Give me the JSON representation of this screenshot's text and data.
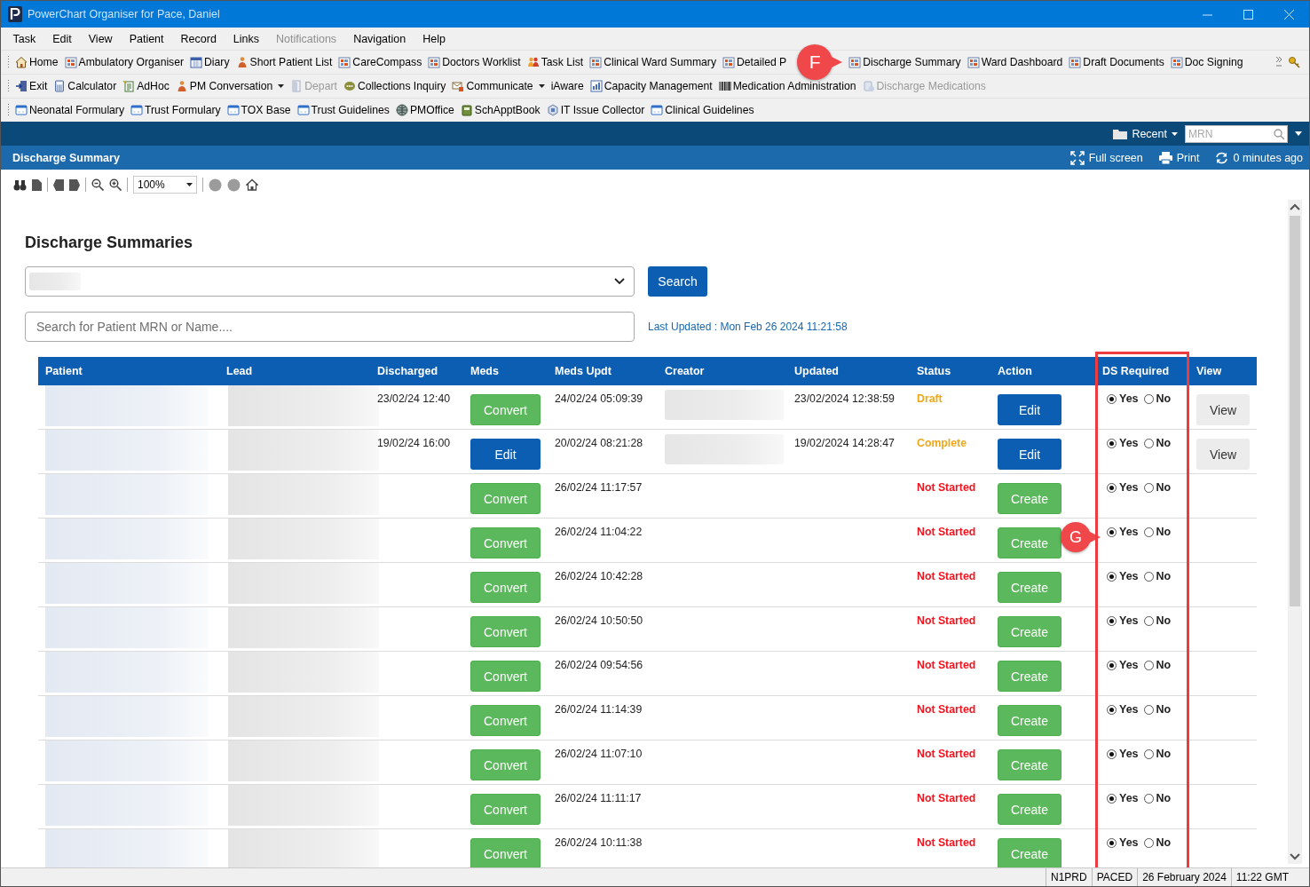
{
  "window": {
    "title": "PowerChart Organiser for Pace, Daniel"
  },
  "menu": [
    {
      "label": "Task",
      "disabled": false
    },
    {
      "label": "Edit",
      "disabled": false
    },
    {
      "label": "View",
      "disabled": false
    },
    {
      "label": "Patient",
      "disabled": false
    },
    {
      "label": "Record",
      "disabled": false
    },
    {
      "label": "Links",
      "disabled": false
    },
    {
      "label": "Notifications",
      "disabled": true
    },
    {
      "label": "Navigation",
      "disabled": false
    },
    {
      "label": "Help",
      "disabled": false
    }
  ],
  "toolbars": [
    {
      "items": [
        {
          "label": "Home",
          "kind": "home"
        },
        {
          "label": "Ambulatory Organiser",
          "kind": "grid"
        },
        {
          "label": "Diary",
          "kind": "calendar"
        },
        {
          "label": "Short Patient List",
          "kind": "person"
        },
        {
          "label": "CareCompass",
          "kind": "grid"
        },
        {
          "label": "Doctors Worklist",
          "kind": "grid"
        },
        {
          "label": "Task List",
          "kind": "people"
        },
        {
          "label": "Clinical Ward Summary",
          "kind": "grid"
        },
        {
          "label": "Detailed P",
          "kind": "grid"
        },
        {
          "label": "Discharge Summary",
          "kind": "grid",
          "callout": "F"
        },
        {
          "label": "Ward Dashboard",
          "kind": "grid"
        },
        {
          "label": "Draft Documents",
          "kind": "grid"
        },
        {
          "label": "Doc Signing",
          "kind": "grid"
        }
      ],
      "tail": true
    },
    {
      "items": [
        {
          "label": "Exit",
          "kind": "exit"
        },
        {
          "label": "Calculator",
          "kind": "calculator"
        },
        {
          "label": "AdHoc",
          "kind": "adhoc"
        },
        {
          "label": "PM Conversation",
          "kind": "person",
          "dropdown": true
        },
        {
          "label": "Depart",
          "kind": "door",
          "disabled": true
        },
        {
          "label": "Collections Inquiry",
          "kind": "chat"
        },
        {
          "label": "Communicate",
          "kind": "envelope",
          "dropdown": true
        },
        {
          "label": "iAware",
          "kind": "none"
        },
        {
          "label": "Capacity Management",
          "kind": "chart"
        },
        {
          "label": "Medication Administration",
          "kind": "barcode"
        },
        {
          "label": "Discharge Medications",
          "kind": "pill",
          "disabled": true
        }
      ],
      "tail": false
    },
    {
      "items": [
        {
          "label": "Neonatal Formulary",
          "kind": "web"
        },
        {
          "label": "Trust Formulary",
          "kind": "web"
        },
        {
          "label": "TOX Base",
          "kind": "web"
        },
        {
          "label": "Trust Guidelines",
          "kind": "web"
        },
        {
          "label": "PMOffice",
          "kind": "globe"
        },
        {
          "label": "SchApptBook",
          "kind": "book"
        },
        {
          "label": "IT Issue Collector",
          "kind": "hex"
        },
        {
          "label": "Clinical Guidelines",
          "kind": "web"
        }
      ],
      "tail": false
    }
  ],
  "nav": {
    "recent": "Recent",
    "mrn_placeholder": "MRN"
  },
  "page_header": {
    "title": "Discharge Summary",
    "actions": [
      {
        "label": "Full screen",
        "kind": "fullscreen"
      },
      {
        "label": "Print",
        "kind": "print"
      },
      {
        "label": "0 minutes ago",
        "kind": "refresh"
      }
    ]
  },
  "viewer": {
    "zoom": "100%"
  },
  "content": {
    "heading": "Discharge Summaries",
    "search_button": "Search",
    "search": {
      "placeholder": "Search for Patient MRN or Name...."
    },
    "last_updated": "Last Updated : Mon Feb 26 2024 11:21:58"
  },
  "table": {
    "columns": [
      {
        "label": "Patient",
        "highlighted": false
      },
      {
        "label": "Lead",
        "highlighted": false
      },
      {
        "label": "Discharged",
        "highlighted": false
      },
      {
        "label": "Meds",
        "highlighted": false
      },
      {
        "label": "Meds Updt",
        "highlighted": false
      },
      {
        "label": "Creator",
        "highlighted": false
      },
      {
        "label": "Updated",
        "highlighted": false
      },
      {
        "label": "Status",
        "highlighted": false
      },
      {
        "label": "Action",
        "highlighted": false
      },
      {
        "label": "DS Required",
        "highlighted": true
      },
      {
        "label": "View",
        "highlighted": false
      }
    ],
    "rows": [
      {
        "discharged": "23/02/24 12:40",
        "meds": {
          "label": "Convert",
          "kind": "convert"
        },
        "meds_updt": "24/02/24 05:09:39",
        "creator_redacted": true,
        "updated": "23/02/2024 12:38:59",
        "status": {
          "label": "Draft",
          "kind": "draft"
        },
        "action": {
          "label": "Edit",
          "kind": "edit"
        },
        "ds": [
          {
            "label": "Yes",
            "selected": true
          },
          {
            "label": "No",
            "selected": false
          }
        ],
        "view": "View"
      },
      {
        "discharged": "19/02/24 16:00",
        "meds": {
          "label": "Edit",
          "kind": "edit"
        },
        "meds_updt": "20/02/24 08:21:28",
        "creator_redacted": true,
        "updated": "19/02/2024 14:28:47",
        "status": {
          "label": "Complete",
          "kind": "complete"
        },
        "action": {
          "label": "Edit",
          "kind": "edit"
        },
        "ds": [
          {
            "label": "Yes",
            "selected": true
          },
          {
            "label": "No",
            "selected": false
          }
        ],
        "view": "View"
      },
      {
        "meds": {
          "label": "Convert",
          "kind": "convert"
        },
        "meds_updt": "26/02/24 11:17:57",
        "creator_redacted": false,
        "status": {
          "label": "Not Started",
          "kind": "not_started"
        },
        "action": {
          "label": "Create",
          "kind": "create"
        },
        "ds": [
          {
            "label": "Yes",
            "selected": true
          },
          {
            "label": "No",
            "selected": false
          }
        ]
      },
      {
        "meds": {
          "label": "Convert",
          "kind": "convert"
        },
        "meds_updt": "26/02/24 11:04:22",
        "creator_redacted": false,
        "status": {
          "label": "Not Started",
          "kind": "not_started"
        },
        "action": {
          "label": "Create",
          "kind": "create"
        },
        "ds": [
          {
            "label": "Yes",
            "selected": true
          },
          {
            "label": "No",
            "selected": false
          }
        ],
        "callout": "G"
      },
      {
        "meds": {
          "label": "Convert",
          "kind": "convert"
        },
        "meds_updt": "26/02/24 10:42:28",
        "creator_redacted": false,
        "status": {
          "label": "Not Started",
          "kind": "not_started"
        },
        "action": {
          "label": "Create",
          "kind": "create"
        },
        "ds": [
          {
            "label": "Yes",
            "selected": true
          },
          {
            "label": "No",
            "selected": false
          }
        ]
      },
      {
        "meds": {
          "label": "Convert",
          "kind": "convert"
        },
        "meds_updt": "26/02/24 10:50:50",
        "creator_redacted": false,
        "status": {
          "label": "Not Started",
          "kind": "not_started"
        },
        "action": {
          "label": "Create",
          "kind": "create"
        },
        "ds": [
          {
            "label": "Yes",
            "selected": true
          },
          {
            "label": "No",
            "selected": false
          }
        ]
      },
      {
        "meds": {
          "label": "Convert",
          "kind": "convert"
        },
        "meds_updt": "26/02/24 09:54:56",
        "creator_redacted": false,
        "status": {
          "label": "Not Started",
          "kind": "not_started"
        },
        "action": {
          "label": "Create",
          "kind": "create"
        },
        "ds": [
          {
            "label": "Yes",
            "selected": true
          },
          {
            "label": "No",
            "selected": false
          }
        ]
      },
      {
        "meds": {
          "label": "Convert",
          "kind": "convert"
        },
        "meds_updt": "26/02/24 11:14:39",
        "creator_redacted": false,
        "status": {
          "label": "Not Started",
          "kind": "not_started"
        },
        "action": {
          "label": "Create",
          "kind": "create"
        },
        "ds": [
          {
            "label": "Yes",
            "selected": true
          },
          {
            "label": "No",
            "selected": false
          }
        ]
      },
      {
        "meds": {
          "label": "Convert",
          "kind": "convert"
        },
        "meds_updt": "26/02/24 11:07:10",
        "creator_redacted": false,
        "status": {
          "label": "Not Started",
          "kind": "not_started"
        },
        "action": {
          "label": "Create",
          "kind": "create"
        },
        "ds": [
          {
            "label": "Yes",
            "selected": true
          },
          {
            "label": "No",
            "selected": false
          }
        ]
      },
      {
        "meds": {
          "label": "Convert",
          "kind": "convert"
        },
        "meds_updt": "26/02/24 11:11:17",
        "creator_redacted": false,
        "status": {
          "label": "Not Started",
          "kind": "not_started"
        },
        "action": {
          "label": "Create",
          "kind": "create"
        },
        "ds": [
          {
            "label": "Yes",
            "selected": true
          },
          {
            "label": "No",
            "selected": false
          }
        ]
      },
      {
        "meds": {
          "label": "Convert",
          "kind": "convert"
        },
        "meds_updt": "26/02/24 10:11:38",
        "creator_redacted": false,
        "status": {
          "label": "Not Started",
          "kind": "not_started"
        },
        "action": {
          "label": "Create",
          "kind": "create"
        },
        "ds": [
          {
            "label": "Yes",
            "selected": true
          },
          {
            "label": "No",
            "selected": false
          }
        ]
      }
    ]
  },
  "status_bar": [
    "N1PRD",
    "PACED",
    "26 February 2024",
    "11:22 GMT"
  ]
}
